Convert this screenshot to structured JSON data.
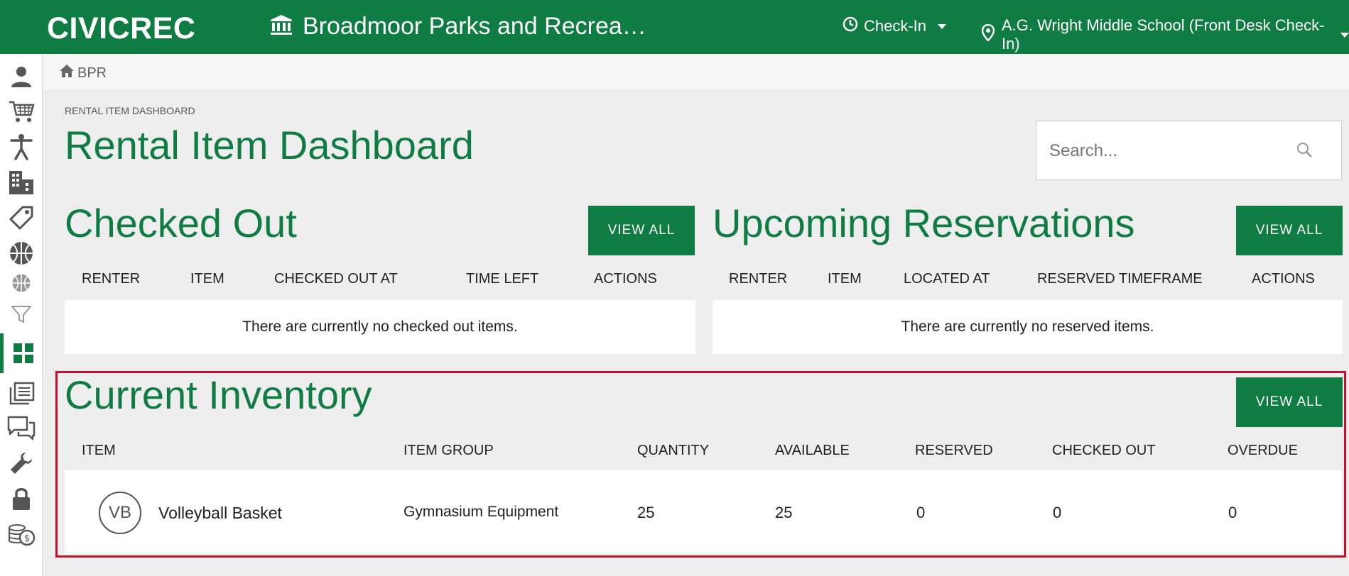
{
  "header": {
    "brand": "CIVICREC",
    "org_name": "Broadmoor Parks and Recrea…",
    "checkin_label": "Check-In",
    "location_label": "A.G. Wright Middle School (Front Desk Check-In)"
  },
  "sidebar": {
    "items": [
      {
        "icon": "person-icon"
      },
      {
        "icon": "cart-icon"
      },
      {
        "icon": "activity-icon"
      },
      {
        "icon": "facilities-icon"
      },
      {
        "icon": "tag-icon"
      },
      {
        "icon": "basketball-icon"
      },
      {
        "icon": "basketball-small-icon"
      },
      {
        "icon": "filter-icon"
      },
      {
        "icon": "dashboard-icon",
        "active": true
      },
      {
        "icon": "documents-icon"
      },
      {
        "icon": "messages-icon"
      },
      {
        "icon": "wrench-icon"
      },
      {
        "icon": "lock-icon"
      },
      {
        "icon": "coins-icon"
      }
    ]
  },
  "breadcrumb": {
    "label": "BPR"
  },
  "page": {
    "eyebrow": "RENTAL ITEM DASHBOARD",
    "title": "Rental Item Dashboard"
  },
  "search": {
    "placeholder": "Search..."
  },
  "checked_out": {
    "title": "Checked Out",
    "view_all": "VIEW ALL",
    "columns": [
      "RENTER",
      "ITEM",
      "CHECKED OUT AT",
      "TIME LEFT",
      "ACTIONS"
    ],
    "empty_message": "There are currently no checked out items."
  },
  "upcoming": {
    "title": "Upcoming Reservations",
    "view_all": "VIEW ALL",
    "columns": [
      "RENTER",
      "ITEM",
      "LOCATED AT",
      "RESERVED TIMEFRAME",
      "ACTIONS"
    ],
    "empty_message": "There are currently no reserved items."
  },
  "inventory": {
    "title": "Current Inventory",
    "view_all": "VIEW ALL",
    "columns": [
      "ITEM",
      "ITEM GROUP",
      "QUANTITY",
      "AVAILABLE",
      "RESERVED",
      "CHECKED OUT",
      "OVERDUE"
    ],
    "rows": [
      {
        "initials": "VB",
        "item": "Volleyball Basket",
        "group": "Gymnasium Equipment",
        "quantity": "25",
        "available": "25",
        "reserved": "0",
        "checked_out": "0",
        "overdue": "0"
      }
    ]
  },
  "colors": {
    "brand_green": "#0f7d43",
    "highlight_red": "#c8102e"
  }
}
